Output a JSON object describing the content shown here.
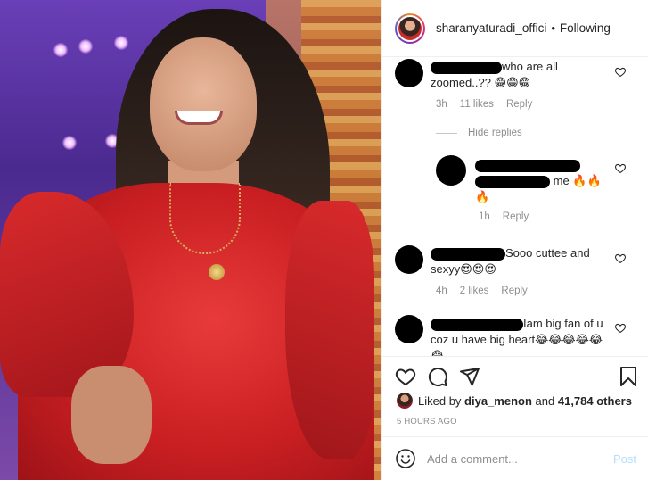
{
  "post": {
    "username": "sharanyaturadi_offici",
    "follow_status": "Following",
    "separator": "•"
  },
  "comments": [
    {
      "text": "who are all zoomed..?? 😁😁😁",
      "time": "3h",
      "likes": "11 likes",
      "reply_label": "Reply",
      "hide_replies_label": "Hide replies"
    },
    {
      "text": "me 🔥🔥🔥",
      "time": "1h",
      "reply_label": "Reply",
      "is_reply": true
    },
    {
      "text": "Sooo cuttee and sexyy😍😍😍",
      "time": "4h",
      "likes": "2 likes",
      "reply_label": "Reply"
    },
    {
      "text": "Iam big fan of u coz u have big heart😂😂😂😂😂😂"
    }
  ],
  "likes": {
    "prefix": "Liked by",
    "user": "diya_menon",
    "conjunction": "and",
    "others": "41,784 others"
  },
  "timestamp": "5 HOURS AGO",
  "add_comment": {
    "placeholder": "Add a comment...",
    "post_label": "Post"
  },
  "colors": {
    "link_blue_disabled": "#b2dffc",
    "secondary_text": "#8e8e8e",
    "primary_text": "#262626"
  },
  "icons": [
    "heart-icon",
    "comment-icon",
    "share-icon",
    "bookmark-icon",
    "emoji-icon",
    "small-heart-icon"
  ]
}
